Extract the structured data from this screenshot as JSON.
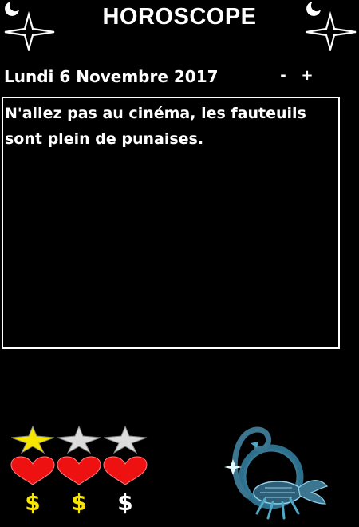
{
  "header": {
    "title": "HOROSCOPE"
  },
  "date_bar": {
    "date": "Lundi 6 Novembre 2017",
    "prev_label": "-",
    "next_label": "+"
  },
  "prediction": {
    "text": "N'allez pas au cinéma, les fauteuils sont plein de punaises."
  },
  "ratings": {
    "stars": {
      "filled": 1,
      "max": 3
    },
    "hearts": {
      "filled": 3,
      "max": 3
    },
    "money": {
      "filled": 2,
      "max": 3,
      "symbols": [
        "$",
        "$",
        "$"
      ]
    }
  },
  "sign": {
    "icon": "scorpion-icon"
  },
  "colors": {
    "background": "#000000",
    "text": "#ffffff",
    "star_filled": "#f7e600",
    "star_empty": "#dcdcdc",
    "heart": "#ee1111",
    "money_filled": "#f7e600",
    "money_empty": "#ffffff",
    "sign_accent": "#4fa9c8"
  }
}
